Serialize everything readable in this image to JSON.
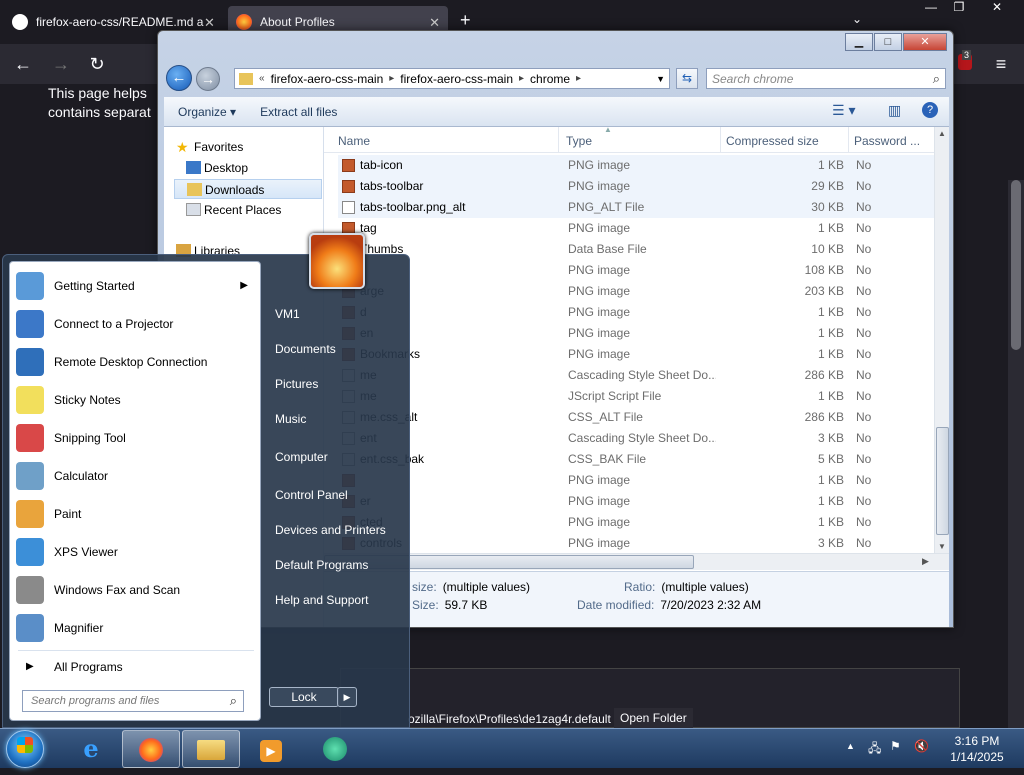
{
  "firefox": {
    "tabs": [
      {
        "title": "firefox-aero-css/README.md a"
      },
      {
        "title": "About Profiles"
      }
    ],
    "new_tab": "+",
    "list_all_tabs": "⌄",
    "page_text_line1": "This page helps",
    "page_text_line2": "contains separat",
    "profile_path": "ozilla\\Firefox\\Profiles\\de1zag4r.default",
    "open_folder": "Open Folder",
    "ext_badge": "3"
  },
  "explorer": {
    "address": {
      "prefix": "«",
      "crumbs": [
        "firefox-aero-css-main",
        "firefox-aero-css-main",
        "chrome"
      ]
    },
    "search_placeholder": "Search chrome",
    "toolbar": {
      "organize": "Organize",
      "extract": "Extract all files"
    },
    "nav": {
      "favorites": "Favorites",
      "desktop": "Desktop",
      "downloads": "Downloads",
      "recent": "Recent Places",
      "libraries": "Libraries"
    },
    "columns": {
      "name": "Name",
      "type": "Type",
      "size": "Compressed size",
      "password": "Password ..."
    },
    "rows": [
      {
        "name": "tab-icon",
        "type": "PNG image",
        "size": "1 KB",
        "pw": "No"
      },
      {
        "name": "tabs-toolbar",
        "type": "PNG image",
        "size": "29 KB",
        "pw": "No"
      },
      {
        "name": "tabs-toolbar.png_alt",
        "type": "PNG_ALT File",
        "size": "30 KB",
        "pw": "No"
      },
      {
        "name": "tag",
        "type": "PNG image",
        "size": "1 KB",
        "pw": "No"
      },
      {
        "name": "Thumbs",
        "type": "Data Base File",
        "size": "10 KB",
        "pw": "No"
      },
      {
        "name": "",
        "type": "PNG image",
        "size": "108 KB",
        "pw": "No"
      },
      {
        "name": "arge",
        "type": "PNG image",
        "size": "203 KB",
        "pw": "No"
      },
      {
        "name": "d",
        "type": "PNG image",
        "size": "1 KB",
        "pw": "No"
      },
      {
        "name": "en",
        "type": "PNG image",
        "size": "1 KB",
        "pw": "No"
      },
      {
        "name": "Bookmarks",
        "type": "PNG image",
        "size": "1 KB",
        "pw": "No"
      },
      {
        "name": "me",
        "type": "Cascading Style Sheet Do...",
        "size": "286 KB",
        "pw": "No"
      },
      {
        "name": "me",
        "type": "JScript Script File",
        "size": "1 KB",
        "pw": "No"
      },
      {
        "name": "me.css_alt",
        "type": "CSS_ALT File",
        "size": "286 KB",
        "pw": "No"
      },
      {
        "name": "ent",
        "type": "Cascading Style Sheet Do...",
        "size": "3 KB",
        "pw": "No"
      },
      {
        "name": "ent.css_bak",
        "type": "CSS_BAK File",
        "size": "5 KB",
        "pw": "No"
      },
      {
        "name": "",
        "type": "PNG image",
        "size": "1 KB",
        "pw": "No"
      },
      {
        "name": "er",
        "type": "PNG image",
        "size": "1 KB",
        "pw": "No"
      },
      {
        "name": "cted",
        "type": "PNG image",
        "size": "1 KB",
        "pw": "No"
      },
      {
        "name": "controls",
        "type": "PNG image",
        "size": "3 KB",
        "pw": "No"
      }
    ],
    "details": {
      "size_k": "size:",
      "size_v": "(multiple values)",
      "ratio_k": "Ratio:",
      "ratio_v": "(multiple values)",
      "size2_k": "Size:",
      "size2_v": "59.7 KB",
      "date_k": "Date modified:",
      "date_v": "7/20/2023 2:32 AM"
    }
  },
  "start_menu": {
    "programs": [
      {
        "label": "Getting Started",
        "icon": "getting-started-icon",
        "color": "#5a9ad8",
        "arrow": true
      },
      {
        "label": "Connect to a Projector",
        "icon": "projector-icon",
        "color": "#3c78c8",
        "arrow": false
      },
      {
        "label": "Remote Desktop Connection",
        "icon": "remote-desktop-icon",
        "color": "#2f6fba",
        "arrow": false
      },
      {
        "label": "Sticky Notes",
        "icon": "sticky-notes-icon",
        "color": "#f2df5c",
        "arrow": false
      },
      {
        "label": "Snipping Tool",
        "icon": "snipping-tool-icon",
        "color": "#d94848",
        "arrow": false
      },
      {
        "label": "Calculator",
        "icon": "calculator-icon",
        "color": "#6fa0c8",
        "arrow": false
      },
      {
        "label": "Paint",
        "icon": "paint-icon",
        "color": "#e9a43c",
        "arrow": false
      },
      {
        "label": "XPS Viewer",
        "icon": "xps-viewer-icon",
        "color": "#3c8fd8",
        "arrow": false
      },
      {
        "label": "Windows Fax and Scan",
        "icon": "fax-scan-icon",
        "color": "#8a8a8a",
        "arrow": false
      },
      {
        "label": "Magnifier",
        "icon": "magnifier-icon",
        "color": "#5a8ec8",
        "arrow": false
      }
    ],
    "all_programs": "All Programs",
    "search_placeholder": "Search programs and files",
    "right": [
      "VM1",
      "Documents",
      "Pictures",
      "Music",
      "Computer",
      "Control Panel",
      "Devices and Printers",
      "Default Programs",
      "Help and Support"
    ],
    "lock": "Lock"
  },
  "taskbar": {
    "clock_time": "3:16 PM",
    "clock_date": "1/14/2025"
  }
}
